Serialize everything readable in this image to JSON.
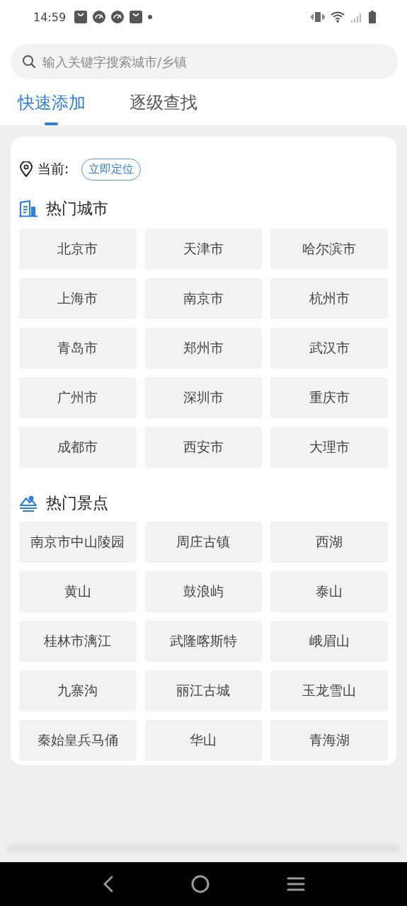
{
  "status_bar": {
    "time": "14:59"
  },
  "search": {
    "placeholder": "输入关键字搜索城市/乡镇"
  },
  "tabs": [
    {
      "label": "快速添加",
      "selected": true
    },
    {
      "label": "逐级查找",
      "selected": false
    }
  ],
  "location": {
    "label": "当前:",
    "button": "立即定位"
  },
  "sections": [
    {
      "kind": "city",
      "title": "热门城市",
      "items": [
        "北京市",
        "天津市",
        "哈尔滨市",
        "上海市",
        "南京市",
        "杭州市",
        "青岛市",
        "郑州市",
        "武汉市",
        "广州市",
        "深圳市",
        "重庆市",
        "成都市",
        "西安市",
        "大理市"
      ]
    },
    {
      "kind": "scenic",
      "title": "热门景点",
      "items": [
        "南京市中山陵园",
        "周庄古镇",
        "西湖",
        "黄山",
        "鼓浪屿",
        "泰山",
        "桂林市漓江",
        "武隆喀斯特",
        "峨眉山",
        "九寨沟",
        "丽江古城",
        "玉龙雪山",
        "秦始皇兵马俑",
        "华山",
        "青海湖"
      ]
    }
  ]
}
